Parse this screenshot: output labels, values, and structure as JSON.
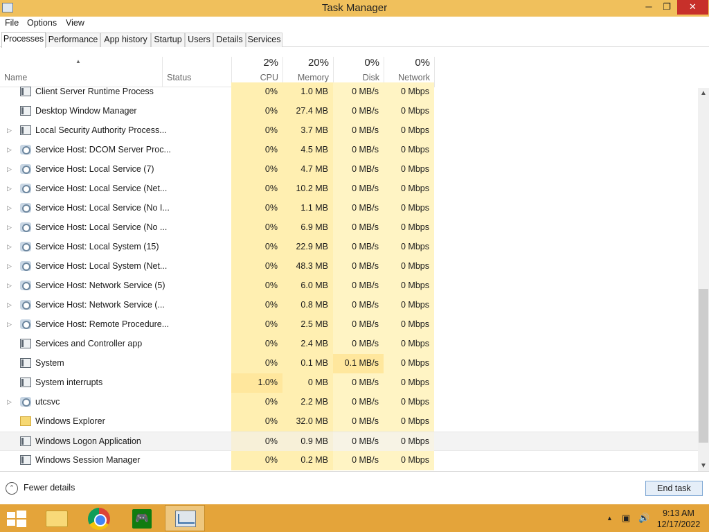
{
  "window": {
    "title": "Task Manager",
    "minimize": "─",
    "maximize": "❐",
    "close": "✕"
  },
  "menu": [
    "File",
    "Options",
    "View"
  ],
  "tabs": [
    "Processes",
    "Performance",
    "App history",
    "Startup",
    "Users",
    "Details",
    "Services"
  ],
  "active_tab": "Processes",
  "columns": {
    "name": "Name",
    "status": "Status",
    "cpu": {
      "pct": "2%",
      "label": "CPU"
    },
    "memory": {
      "pct": "20%",
      "label": "Memory"
    },
    "disk": {
      "pct": "0%",
      "label": "Disk"
    },
    "network": {
      "pct": "0%",
      "label": "Network"
    },
    "sort_indicator": "▲"
  },
  "processes": [
    {
      "name": "Client Server Runtime Process",
      "icon": "window-icon",
      "expandable": false,
      "cpu": "0%",
      "memory": "1.0 MB",
      "disk": "0 MB/s",
      "network": "0 Mbps"
    },
    {
      "name": "Desktop Window Manager",
      "icon": "window-icon",
      "expandable": false,
      "cpu": "0%",
      "memory": "27.4 MB",
      "disk": "0 MB/s",
      "network": "0 Mbps"
    },
    {
      "name": "Local Security Authority Process...",
      "icon": "window-icon",
      "expandable": true,
      "cpu": "0%",
      "memory": "3.7 MB",
      "disk": "0 MB/s",
      "network": "0 Mbps"
    },
    {
      "name": "Service Host: DCOM Server Proc...",
      "icon": "gear-icon",
      "expandable": true,
      "cpu": "0%",
      "memory": "4.5 MB",
      "disk": "0 MB/s",
      "network": "0 Mbps"
    },
    {
      "name": "Service Host: Local Service (7)",
      "icon": "gear-icon",
      "expandable": true,
      "cpu": "0%",
      "memory": "4.7 MB",
      "disk": "0 MB/s",
      "network": "0 Mbps"
    },
    {
      "name": "Service Host: Local Service (Net...",
      "icon": "gear-icon",
      "expandable": true,
      "cpu": "0%",
      "memory": "10.2 MB",
      "disk": "0 MB/s",
      "network": "0 Mbps"
    },
    {
      "name": "Service Host: Local Service (No I...",
      "icon": "gear-icon",
      "expandable": true,
      "cpu": "0%",
      "memory": "1.1 MB",
      "disk": "0 MB/s",
      "network": "0 Mbps"
    },
    {
      "name": "Service Host: Local Service (No ...",
      "icon": "gear-icon",
      "expandable": true,
      "cpu": "0%",
      "memory": "6.9 MB",
      "disk": "0 MB/s",
      "network": "0 Mbps"
    },
    {
      "name": "Service Host: Local System (15)",
      "icon": "gear-icon",
      "expandable": true,
      "cpu": "0%",
      "memory": "22.9 MB",
      "disk": "0 MB/s",
      "network": "0 Mbps"
    },
    {
      "name": "Service Host: Local System (Net...",
      "icon": "gear-icon",
      "expandable": true,
      "cpu": "0%",
      "memory": "48.3 MB",
      "disk": "0 MB/s",
      "network": "0 Mbps"
    },
    {
      "name": "Service Host: Network Service (5)",
      "icon": "gear-icon",
      "expandable": true,
      "cpu": "0%",
      "memory": "6.0 MB",
      "disk": "0 MB/s",
      "network": "0 Mbps"
    },
    {
      "name": "Service Host: Network Service (...",
      "icon": "gear-icon",
      "expandable": true,
      "cpu": "0%",
      "memory": "0.8 MB",
      "disk": "0 MB/s",
      "network": "0 Mbps"
    },
    {
      "name": "Service Host: Remote Procedure...",
      "icon": "gear-icon",
      "expandable": true,
      "cpu": "0%",
      "memory": "2.5 MB",
      "disk": "0 MB/s",
      "network": "0 Mbps"
    },
    {
      "name": "Services and Controller app",
      "icon": "window-icon",
      "expandable": false,
      "cpu": "0%",
      "memory": "2.4 MB",
      "disk": "0 MB/s",
      "network": "0 Mbps"
    },
    {
      "name": "System",
      "icon": "window-icon",
      "expandable": false,
      "cpu": "0%",
      "memory": "0.1 MB",
      "disk": "0.1 MB/s",
      "network": "0 Mbps"
    },
    {
      "name": "System interrupts",
      "icon": "window-icon",
      "expandable": false,
      "cpu": "1.0%",
      "memory": "0 MB",
      "disk": "0 MB/s",
      "network": "0 Mbps"
    },
    {
      "name": "utcsvc",
      "icon": "gear-icon",
      "expandable": true,
      "cpu": "0%",
      "memory": "2.2 MB",
      "disk": "0 MB/s",
      "network": "0 Mbps"
    },
    {
      "name": "Windows Explorer",
      "icon": "folder-icon",
      "expandable": false,
      "cpu": "0%",
      "memory": "32.0 MB",
      "disk": "0 MB/s",
      "network": "0 Mbps"
    },
    {
      "name": "Windows Logon Application",
      "icon": "window-icon",
      "expandable": false,
      "selected": true,
      "cpu": "0%",
      "memory": "0.9 MB",
      "disk": "0 MB/s",
      "network": "0 Mbps"
    },
    {
      "name": "Windows Session Manager",
      "icon": "window-icon",
      "expandable": false,
      "cpu": "0%",
      "memory": "0.2 MB",
      "disk": "0 MB/s",
      "network": "0 Mbps"
    }
  ],
  "footer": {
    "fewer_details": "Fewer details",
    "fewer_glyph": "⌃",
    "end_task": "End task"
  },
  "taskbar": {
    "apps": [
      "folder-icon",
      "chrome-icon",
      "xbox-icon",
      "task-manager-icon"
    ],
    "tray": {
      "chevron": "▲",
      "network_glyph": "▣",
      "volume_glyph": "🔊"
    },
    "time": "9:13 AM",
    "date": "12/17/2022"
  },
  "colors": {
    "titlebar": "#f0c05c",
    "taskbar": "#e4a43a",
    "close": "#c7302a",
    "heat_light": "#fff4c4",
    "heat_mid": "#ffefb1",
    "heat_strong": "#ffe79d"
  }
}
